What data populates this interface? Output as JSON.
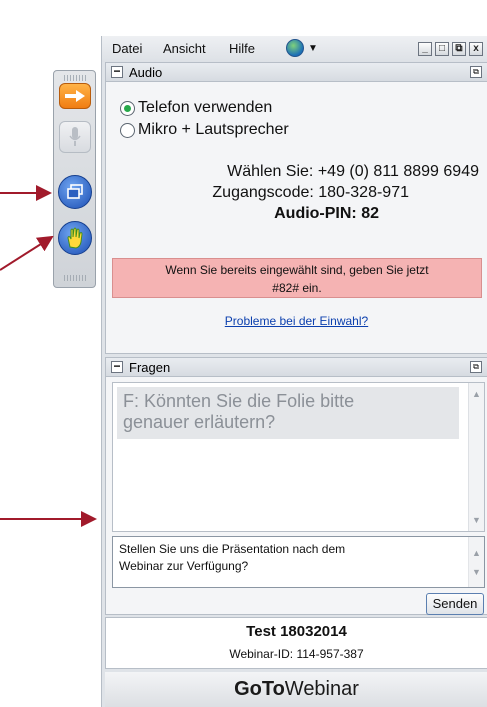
{
  "menu": {
    "file": "Datei",
    "view": "Ansicht",
    "help": "Hilfe"
  },
  "window_controls": {
    "minimize": "_",
    "restore": "□",
    "popout": "⧉",
    "close": "x"
  },
  "audio": {
    "title": "Audio",
    "option_phone": "Telefon verwenden",
    "option_mic": "Mikro + Lautsprecher",
    "selected": "Telefon verwenden",
    "dial": "Wählen Sie: +49 (0) 811 8899 6949",
    "access_code": "Zugangscode: 180-328-971",
    "audio_pin": "Audio-PIN: 82",
    "notice_line1": "Wenn Sie bereits eingewählt sind, geben Sie jetzt",
    "notice_line2": "#82# ein.",
    "problems_link": "Probleme bei der Einwahl?"
  },
  "questions": {
    "title": "Fragen",
    "item_line1": "F: Könnten Sie die Folie bitte",
    "item_line2": "genauer erläutern?",
    "input_line1": "Stellen Sie uns die Präsentation nach dem",
    "input_line2": "Webinar zur Verfügung?",
    "send_label": "Senden"
  },
  "webinar": {
    "title": "Test 18032014",
    "id": "Webinar-ID: 114-957-387",
    "brand_bold": "GoTo",
    "brand_rest": "Webinar"
  },
  "icons": {
    "toolbar": [
      "arrow-right-icon",
      "microphone-icon",
      "window-icon",
      "raise-hand-icon"
    ],
    "menu": "globe-icon"
  },
  "colors": {
    "accent_orange": "#f07d12",
    "toolbar_blue": "#1c4fb4",
    "notice_bg": "#f5b3b3",
    "arrow": "#a11a2b",
    "link": "#0b3fae"
  }
}
